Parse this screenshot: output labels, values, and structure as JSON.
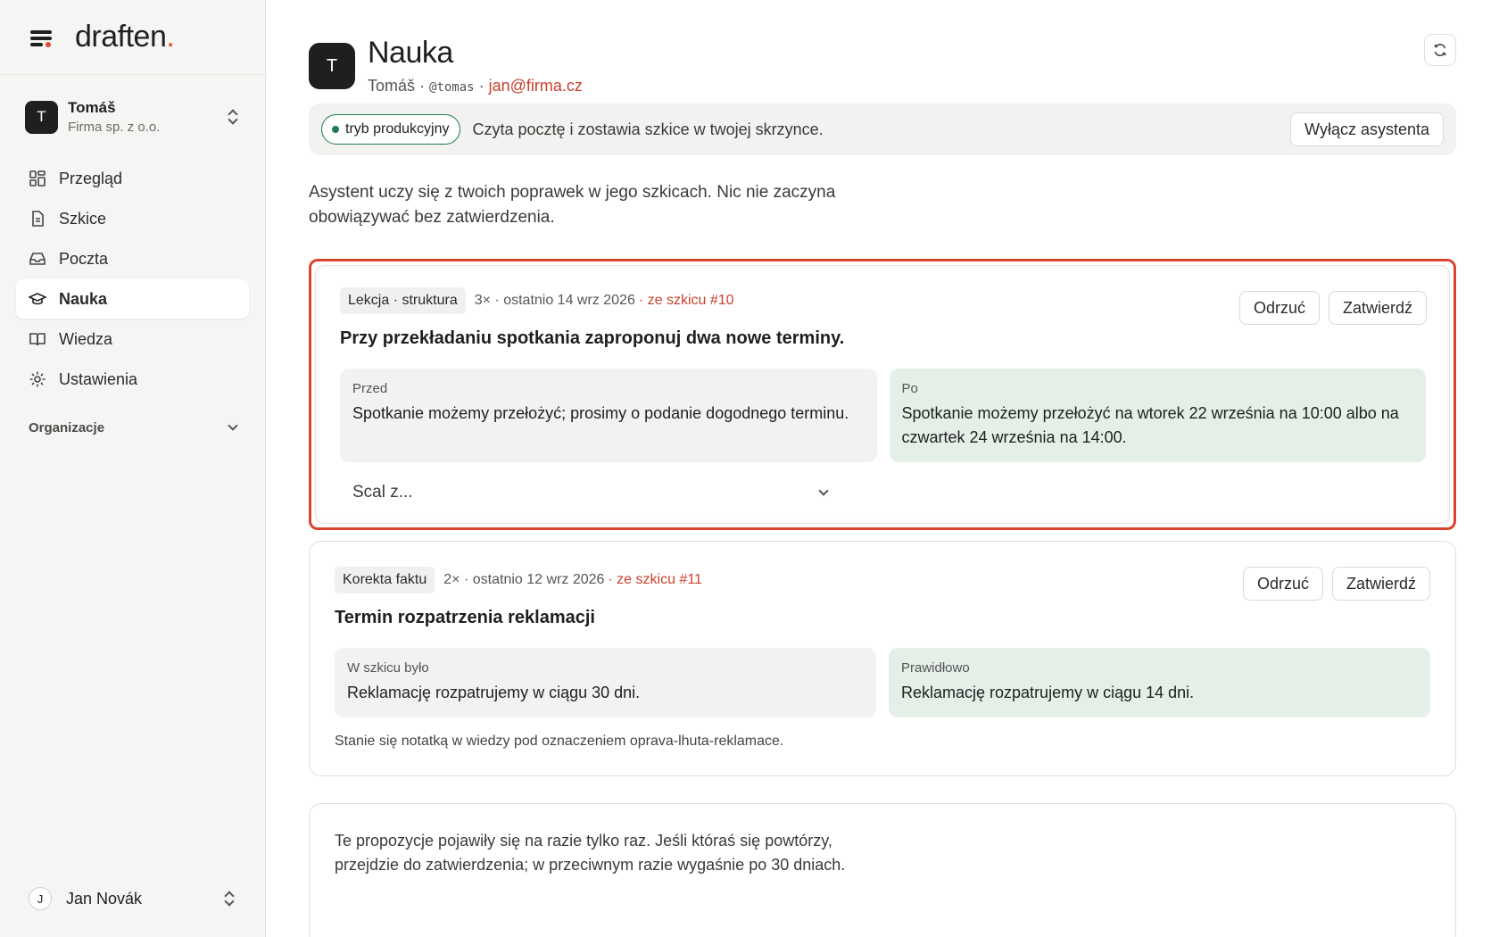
{
  "brand": {
    "logo_text": "draften",
    "logo_dot": "."
  },
  "account": {
    "initial": "T",
    "name": "Tomáš",
    "org": "Firma sp. z o.o."
  },
  "nav": {
    "items": [
      {
        "label": "Przegląd",
        "icon": "dashboard-icon"
      },
      {
        "label": "Szkice",
        "icon": "document-icon"
      },
      {
        "label": "Poczta",
        "icon": "inbox-icon"
      },
      {
        "label": "Nauka",
        "icon": "graduation-cap-icon",
        "active": true
      },
      {
        "label": "Wiedza",
        "icon": "book-icon"
      },
      {
        "label": "Ustawienia",
        "icon": "gear-icon"
      }
    ],
    "section_label": "Organizacje"
  },
  "user": {
    "initial": "J",
    "name": "Jan Novák"
  },
  "header": {
    "initial": "T",
    "title": "Nauka",
    "owner": "Tomáš",
    "sep1": " · ",
    "handle": "@tomas",
    "sep2": " · ",
    "email": "jan@firma.cz"
  },
  "banner": {
    "mode": "tryb produkcyjny",
    "text": "Czyta pocztę i zostawia szkice w twojej skrzynce.",
    "disable_label": "Wyłącz asystenta"
  },
  "intro": "Asystent uczy się z twoich poprawek w jego szkicach. Nic nie zaczyna obowiązywać bez zatwierdzenia.",
  "cards": [
    {
      "tag": "Lekcja · struktura",
      "count": "3×",
      "last": "· ostatnio 14 wrz 2026",
      "source": "· ze szkicu #10",
      "title": "Przy przekładaniu spotkania zaproponuj dwa nowe terminy.",
      "left_label": "Przed",
      "left_text": "Spotkanie możemy przełożyć; prosimy o podanie dogodnego terminu.",
      "right_label": "Po",
      "right_text": "Spotkanie możemy przełożyć na wtorek 22 września na 10:00 albo na czwartek 24 września na 14:00.",
      "merge_placeholder": "Scal z...",
      "reject_label": "Odrzuć",
      "approve_label": "Zatwierdź"
    },
    {
      "tag": "Korekta faktu",
      "count": "2×",
      "last": "· ostatnio 12 wrz 2026",
      "source": "· ze szkicu #11",
      "title": "Termin rozpatrzenia reklamacji",
      "left_label": "W szkicu było",
      "left_text": "Reklamację rozpatrujemy w ciągu 30 dni.",
      "right_label": "Prawidłowo",
      "right_text": "Reklamację rozpatrujemy w ciągu 14 dni.",
      "note": "Stanie się notatką w wiedzy pod oznaczeniem oprava-lhuta-reklamace.",
      "reject_label": "Odrzuć",
      "approve_label": "Zatwierdź"
    }
  ],
  "pending_note": "Te propozycje pojawiły się na razie tylko raz. Jeśli któraś się powtórzy, przejdzie do zatwierdzenia; w przeciwnym razie wygaśnie po 30 dniach.",
  "colors": {
    "accent": "#d9442f",
    "success": "#1f7a4d",
    "after_bg": "#e4efe8"
  }
}
